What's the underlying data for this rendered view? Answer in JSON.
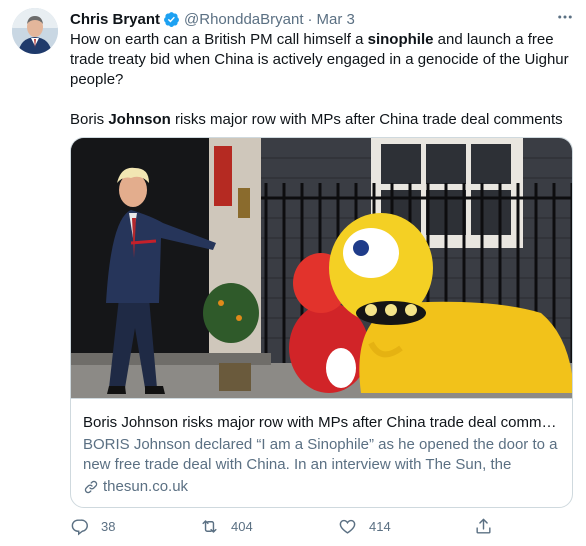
{
  "author": {
    "name": "Chris Bryant",
    "handle": "@RhonddaBryant",
    "separator": "·",
    "date": "Mar 3"
  },
  "text": {
    "line1_pre": "How on earth can a British PM call himself a ",
    "line1_bold": "sinophile",
    "line1_post": " and launch a free trade treaty bid when China is actively engaged in a genocide of the Uighur people?",
    "line2_pre": "Boris ",
    "line2_bold": "Johnson",
    "line2_post": " risks major row with MPs after China trade deal comments"
  },
  "card": {
    "title": "Boris Johnson risks major row with MPs after China trade deal comme...",
    "description": "BORIS Johnson declared “I am a Sinophile” as he opened the door to a new free trade deal with China. In an interview with The Sun, the Prime...",
    "domain": "thesun.co.uk"
  },
  "actions": {
    "replies": "38",
    "retweets": "404",
    "likes": "414"
  },
  "icons": {
    "verified": "verified-badge-icon",
    "more": "more-icon",
    "link": "link-icon",
    "reply": "reply-icon",
    "retweet": "retweet-icon",
    "like": "heart-icon",
    "share": "share-icon"
  },
  "colors": {
    "verified": "#1da1f2",
    "secondary_text": "#5b7083",
    "primary_text": "#0f1419",
    "border": "#cfd9de"
  }
}
